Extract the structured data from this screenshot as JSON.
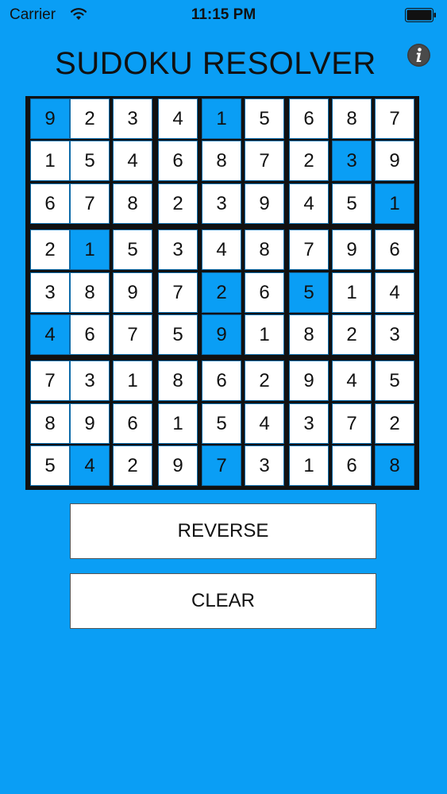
{
  "status_bar": {
    "carrier": "Carrier",
    "time": "11:15 PM",
    "icons": [
      "wifi-icon",
      "battery-icon"
    ]
  },
  "app": {
    "title": "SUDOKU RESOLVER",
    "info_icon": "info-icon"
  },
  "grid": {
    "rows": [
      [
        9,
        2,
        3,
        4,
        1,
        5,
        6,
        8,
        7
      ],
      [
        1,
        5,
        4,
        6,
        8,
        7,
        2,
        3,
        9
      ],
      [
        6,
        7,
        8,
        2,
        3,
        9,
        4,
        5,
        1
      ],
      [
        2,
        1,
        5,
        3,
        4,
        8,
        7,
        9,
        6
      ],
      [
        3,
        8,
        9,
        7,
        2,
        6,
        5,
        1,
        4
      ],
      [
        4,
        6,
        7,
        5,
        9,
        1,
        8,
        2,
        3
      ],
      [
        7,
        3,
        1,
        8,
        6,
        2,
        9,
        4,
        5
      ],
      [
        8,
        9,
        6,
        1,
        5,
        4,
        3,
        7,
        2
      ],
      [
        5,
        4,
        2,
        9,
        7,
        3,
        1,
        6,
        8
      ]
    ],
    "highlighted": [
      [
        0,
        0
      ],
      [
        0,
        4
      ],
      [
        1,
        7
      ],
      [
        2,
        8
      ],
      [
        3,
        1
      ],
      [
        4,
        4
      ],
      [
        4,
        6
      ],
      [
        5,
        0
      ],
      [
        5,
        4
      ],
      [
        8,
        1
      ],
      [
        8,
        4
      ],
      [
        8,
        8
      ]
    ]
  },
  "buttons": {
    "reverse": "REVERSE",
    "clear": "CLEAR"
  },
  "colors": {
    "background": "#0a9ef5",
    "cell": "#ffffff",
    "highlight": "#0a9ef5",
    "grid_line": "#111111"
  }
}
